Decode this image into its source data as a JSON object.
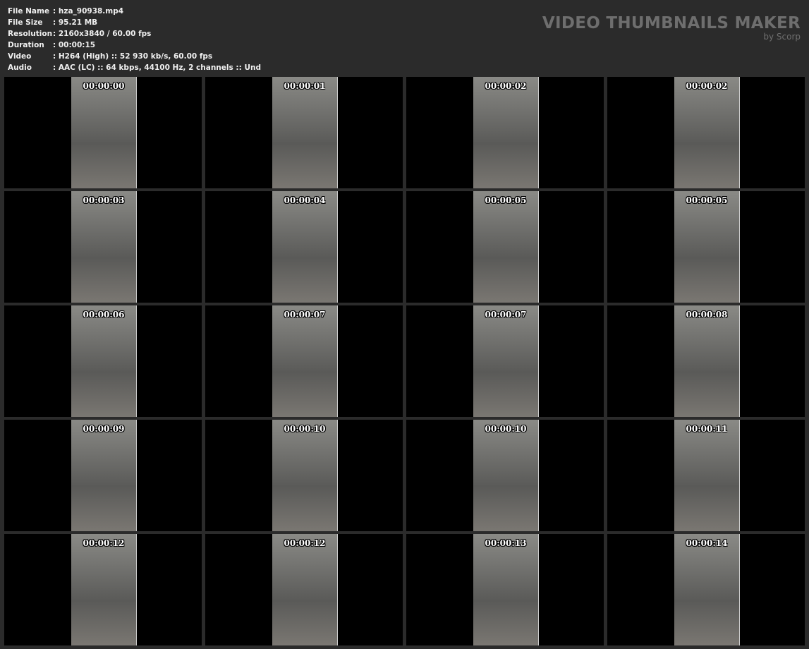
{
  "info": [
    {
      "label": "File Name",
      "value": ": hza_90938.mp4"
    },
    {
      "label": "File Size",
      "value": ": 95.21 MB"
    },
    {
      "label": "Resolution",
      "value": ": 2160x3840 / 60.00 fps"
    },
    {
      "label": "Duration",
      "value": ": 00:00:15"
    },
    {
      "label": "Video",
      "value": ": H264 (High) :: 52 930 kb/s, 60.00 fps"
    },
    {
      "label": "Audio",
      "value": ": AAC (LC) :: 64 kbps, 44100 Hz, 2 channels :: Und"
    }
  ],
  "brand": {
    "title": "VIDEO THUMBNAILS MAKER",
    "sub": "by Scorp"
  },
  "thumbnails": [
    "00:00:00",
    "00:00:01",
    "00:00:02",
    "00:00:02",
    "00:00:03",
    "00:00:04",
    "00:00:05",
    "00:00:05",
    "00:00:06",
    "00:00:07",
    "00:00:07",
    "00:00:08",
    "00:00:09",
    "00:00:10",
    "00:00:10",
    "00:00:11",
    "00:00:12",
    "00:00:12",
    "00:00:13",
    "00:00:14"
  ]
}
